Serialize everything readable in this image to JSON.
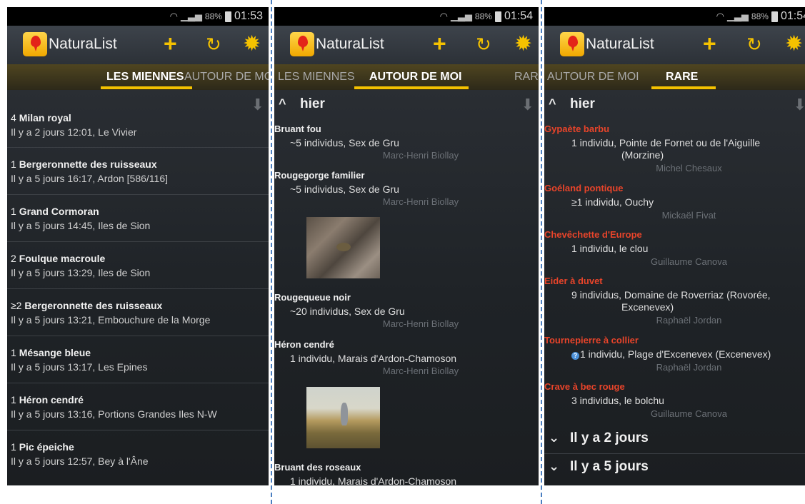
{
  "status": {
    "battery": "88%",
    "time_1": "01:53",
    "time_2": "01:54",
    "time_3": "01:54"
  },
  "app": {
    "name": "NaturaList",
    "add_icon": "+",
    "location_icon": "↻",
    "settings_icon": "✹"
  },
  "tabs": {
    "mine": "LES MIENNES",
    "around": "AUTOUR DE MOI",
    "rare": "RARE",
    "accent_color": "#f5c200"
  },
  "screen1": {
    "items": [
      {
        "count": "4",
        "species": "Milan royal",
        "info": "Il y a 2 jours 12:01, Le Vivier"
      },
      {
        "count": "1",
        "species": "Bergeronnette des ruisseaux",
        "info": "Il y a 5 jours 16:17, Ardon [586/116]"
      },
      {
        "count": "1",
        "species": "Grand Cormoran",
        "info": "Il y a 5 jours 14:45, Iles de Sion"
      },
      {
        "count": "2",
        "species": "Foulque macroule",
        "info": "Il y a 5 jours 13:29, Iles de Sion"
      },
      {
        "count": "≥2",
        "species": "Bergeronnette des ruisseaux",
        "info": "Il y a 5 jours 13:21, Embouchure de la Morge"
      },
      {
        "count": "1",
        "species": "Mésange bleue",
        "info": "Il y a 5 jours 13:17, Les Epines"
      },
      {
        "count": "1",
        "species": "Héron cendré",
        "info": "Il y a 5 jours 13:16, Portions Grandes Iles N-W"
      },
      {
        "count": "1",
        "species": "Pic épeiche",
        "info": "Il y a 5 jours 12:57, Bey à l'Âne"
      }
    ]
  },
  "screen2": {
    "group": "hier",
    "entries": [
      {
        "species": "Bruant fou",
        "detail": "~5 individus, Sex de Gru",
        "observer": "Marc-Henri Biollay"
      },
      {
        "species": "Rougegorge familier",
        "detail": "~5 individus, Sex de Gru",
        "observer": "Marc-Henri Biollay"
      },
      {
        "species": "Rougequeue noir",
        "detail": "~20 individus, Sex de Gru",
        "observer": "Marc-Henri Biollay"
      },
      {
        "species": "Héron cendré",
        "detail": "1 individu, Marais d'Ardon-Chamoson",
        "observer": "Marc-Henri Biollay"
      },
      {
        "species": "Bruant des roseaux",
        "detail": "1 individu, Marais d'Ardon-Chamoson",
        "observer": ""
      }
    ]
  },
  "screen3": {
    "group": "hier",
    "rare_color": "#e8442a",
    "entries": [
      {
        "species": "Gypaète barbu",
        "detail": "1 individu, Pointe de Fornet ou de l'Aiguille",
        "detail_wrap": "(Morzine)",
        "observer": "Michel Chesaux"
      },
      {
        "species": "Goéland pontique",
        "detail": "≥1 individu, Ouchy",
        "detail_wrap": "",
        "observer": "Mickaël Fivat"
      },
      {
        "species": "Chevêchette d'Europe",
        "detail": "1 individu, le clou",
        "detail_wrap": "",
        "observer": "Guillaume Canova"
      },
      {
        "species": "Eider à duvet",
        "detail": "9 individus, Domaine de Roverriaz (Rovorée,",
        "detail_wrap": "Excenevex)",
        "observer": "Raphaël Jordan"
      },
      {
        "species": "Tournepierre à collier",
        "detail": "1 individu, Plage d'Excenevex (Excenevex)",
        "detail_wrap": "",
        "observer": "Raphaël Jordan"
      },
      {
        "species": "Crave à bec rouge",
        "detail": "3 individus, le bolchu",
        "detail_wrap": "",
        "observer": "Guillaume Canova"
      }
    ],
    "collapsed": [
      "Il y a 2 jours",
      "Il y a 5 jours"
    ]
  }
}
